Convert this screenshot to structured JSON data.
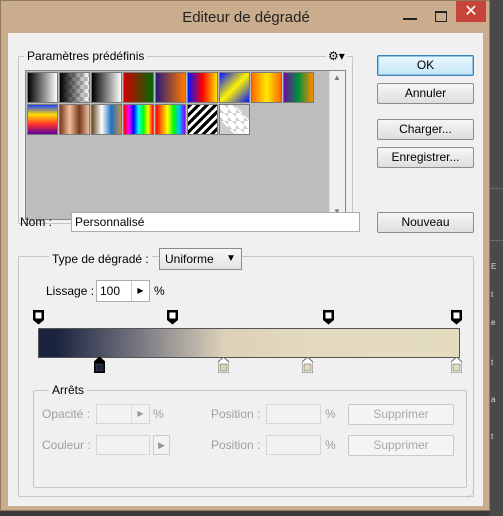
{
  "window": {
    "title": "Editeur de dégradé",
    "close_glyph": "✕"
  },
  "presets": {
    "label": "Paramètres prédéfinis",
    "menu_icon": "gear-icon",
    "swatches": [
      {
        "name": "black-white",
        "css": "linear-gradient(to right,#000,#fff)"
      },
      {
        "name": "black-transparent",
        "css": "linear-gradient(to right,#000,rgba(0,0,0,0))",
        "checker": true
      },
      {
        "name": "white-black",
        "css": "linear-gradient(to right,#000,#fff)"
      },
      {
        "name": "red-green",
        "css": "linear-gradient(to right,#d00000,#006800)"
      },
      {
        "name": "violet-orange",
        "css": "linear-gradient(to right,#2a1a78,#ff7a00)"
      },
      {
        "name": "blue-red-yellow",
        "css": "linear-gradient(to right,#0018ff,#ff0000,#ffe600)"
      },
      {
        "name": "blue-yellow-blue",
        "css": "linear-gradient(135deg,#0018ff,#fff200,#0018ff)"
      },
      {
        "name": "orange-yellow-orange",
        "css": "linear-gradient(to right,#ff6a00,#ffea00,#ff6a00)"
      },
      {
        "name": "violet-green-orange",
        "css": "linear-gradient(to right,#6a0da0,#00903a,#ff8a00)"
      },
      {
        "name": "yellow-violet-orange-blue",
        "css": "linear-gradient(to bottom,#2040ff,#ffdd00,#ff3030,#5a00a0)"
      },
      {
        "name": "copper",
        "css": "linear-gradient(to right,#7a3a1a,#f0c0a0,#7a3a1a,#f0c0a0)"
      },
      {
        "name": "chrome",
        "css": "linear-gradient(to right,#6a4a20,#ffffff,#2070c0,#c09050)"
      },
      {
        "name": "spectrum",
        "css": "linear-gradient(to right,#ff0000,#ff00ff,#0000ff,#00ffff,#00ff00,#ffff00,#ff0000)"
      },
      {
        "name": "transparent-rainbow",
        "css": "linear-gradient(to right,#ff0000,#ff8000,#ffff00,#00ff00,#00c0ff,#8000ff)"
      },
      {
        "name": "transparent-stripes",
        "css": "repeating-linear-gradient(135deg,#000 0 3px,#fff 3px 6px)"
      },
      {
        "name": "transparent",
        "css": "rgba(0,0,0,0)",
        "checker": true
      }
    ]
  },
  "buttons": {
    "ok": "OK",
    "cancel": "Annuler",
    "load": "Charger...",
    "save": "Enregistrer...",
    "new": "Nouveau"
  },
  "name": {
    "label": "Nom :",
    "value": "Personnalisé"
  },
  "gradient_type": {
    "label": "Type de dégradé :",
    "value": "Uniforme",
    "dropdown_icon": "chevron-down-icon"
  },
  "smoothness": {
    "label": "Lissage :",
    "value": "100",
    "unit": "%"
  },
  "ramp": {
    "opacity_stops": [
      0,
      0.32,
      0.69,
      0.995
    ],
    "color_stops": [
      {
        "pos": 0.145,
        "color": "#1a233f",
        "selected": true
      },
      {
        "pos": 0.44,
        "color": "#ddd1b8"
      },
      {
        "pos": 0.64,
        "color": "#e3dac0"
      },
      {
        "pos": 0.995,
        "color": "#e5dcc0"
      }
    ]
  },
  "stops": {
    "label": "Arrêts",
    "opacity_label": "Opacité :",
    "opacity_unit": "%",
    "position_label_1": "Position :",
    "position_unit_1": "%",
    "delete_1": "Supprimer",
    "color_label": "Couleur :",
    "position_label_2": "Position :",
    "position_unit_2": "%",
    "delete_2": "Supprimer"
  }
}
